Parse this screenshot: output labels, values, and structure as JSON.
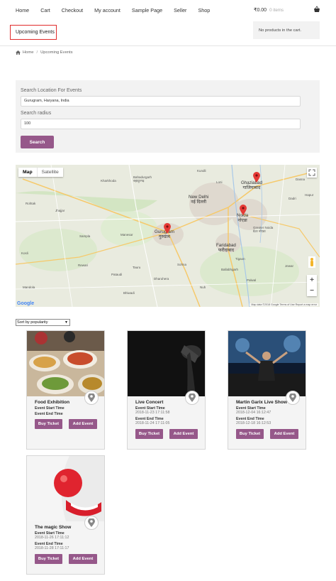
{
  "nav": {
    "items": [
      "Home",
      "Cart",
      "Checkout",
      "My account",
      "Sample Page",
      "Seller",
      "Shop"
    ]
  },
  "cart": {
    "total": "₹0.00",
    "count": "0 items",
    "empty_message": "No products in the cart."
  },
  "page": {
    "title": "Upcoming Events"
  },
  "breadcrumb": {
    "home": "Home",
    "current": "Upcoming Events"
  },
  "search": {
    "location_label": "Search Location For Events",
    "location_value": "Gurugram, Haryana, India",
    "radius_label": "Search radius",
    "radius_value": "100",
    "button_label": "Search"
  },
  "map": {
    "tab_map": "Map",
    "tab_satellite": "Satellite",
    "zoom_in": "+",
    "zoom_out": "−",
    "google": "Google",
    "attribution": "Map data ©2018 Google   Terms of Use   Report a map error",
    "cities": [
      {
        "name": "New Delhi",
        "local": "नई दिल्ली"
      },
      {
        "name": "Ghaziabad",
        "local": "गाजियाबाद"
      },
      {
        "name": "Noida",
        "local": "नोएडा"
      },
      {
        "name": "Gurugram",
        "local": "गुरुग्राम"
      },
      {
        "name": "Faridabad",
        "local": "फरीदाबाद"
      },
      {
        "name": "Greater Noida",
        "local": "ग्रेटर नोएडा"
      },
      {
        "name": "Bahadurgarh",
        "local": "बहादुरगढ़"
      }
    ],
    "places": [
      "Rohtak",
      "Jhajjar",
      "Rewari",
      "Sohna",
      "Palwal",
      "Bhiwadi",
      "Dadri",
      "Dasna",
      "Hapur",
      "Rewari",
      "Pataudi",
      "Tigaon",
      "Jewar",
      "Loni",
      "Kundli",
      "Sampla",
      "Kharkhoda",
      "Kosli",
      "Dharuhera",
      "Ballabhgarh",
      "Tauru",
      "Manesar",
      "Nuh",
      "Mandola",
      "Bilaspur",
      "Dhaulana",
      "Farrukhnagar",
      "Hodal",
      "Baghpat",
      "Sonipat",
      "Kanwali",
      "Nilokheri",
      "Ujina",
      "Hathin",
      "Jahangirpur",
      "Rabupura"
    ],
    "markers": [
      "Ghaziabad",
      "Noida",
      "Gurugram"
    ]
  },
  "sort": {
    "selected": "Sort by popularity"
  },
  "events": [
    {
      "title": "Food Exhibition",
      "start_label": "Event Start Time",
      "start": "",
      "end_label": "Event End Time",
      "end": "",
      "buy": "Buy Ticket",
      "add": "Add Event"
    },
    {
      "title": "Live Concert",
      "start_label": "Event Start Time",
      "start": "2018-11-23 17:11:58",
      "end_label": "Event End Time",
      "end": "2018-11-24 17:11:05",
      "buy": "Buy Ticket",
      "add": "Add Event"
    },
    {
      "title": "Martin Garix Live Show",
      "start_label": "Event Start Time",
      "start": "2018-12-04 16:12:47",
      "end_label": "Event End Time",
      "end": "2018-12-18 16:12:53",
      "buy": "Buy Ticket",
      "add": "Add Event"
    },
    {
      "title": "The magic Show",
      "start_label": "Event Start Time",
      "start": "2018-11-26 17:11:12",
      "end_label": "Event End Time",
      "end": "2018-11-28 17:11:17",
      "buy": "Buy Ticket",
      "add": "Add Event"
    }
  ],
  "colors": {
    "accent": "#96588a",
    "highlight_border": "#e02b2b",
    "panel": "#f2f2f2"
  }
}
